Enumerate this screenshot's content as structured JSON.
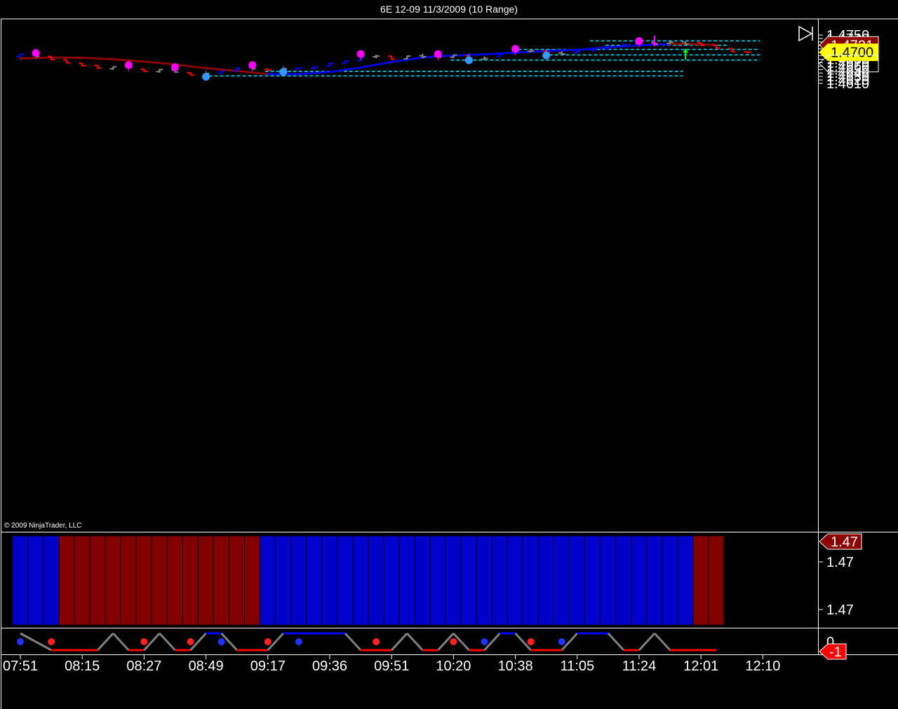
{
  "window": {
    "title": "6E 12-09  11/3/2009 (10 Range)"
  },
  "copyright": "© 2009 NinjaTrader, LLC",
  "colors": {
    "background": "#000000",
    "up_bar": "#0000ff",
    "down_bar": "#ff0000",
    "neutral_bar": "#808080",
    "ma_up": "#0000e0",
    "ma_down": "#8b0000",
    "level_line": "#00e5ff",
    "high_dot": "#ff00ff",
    "low_dot": "#3399ff",
    "last_badge_bg": "#ffff00",
    "prev_badge_bg": "#8b0000",
    "panel_up": "#0000cc",
    "panel_down": "#800000",
    "osc_line": "#808080"
  },
  "chart_data": [
    {
      "type": "ohlc",
      "title": "6E 12-09  11/3/2009 (10 Range)",
      "ylim": [
        1.4605,
        1.4755
      ],
      "yticks": [
        "1.4750",
        "1.4740",
        "1.4730",
        "1.4720",
        "1.4710",
        "1.4700",
        "1.4690",
        "1.4680",
        "1.4670",
        "1.4660",
        "1.4650",
        "1.4640",
        "1.4630",
        "1.4620",
        "1.4610"
      ],
      "ytick_values": [
        1.475,
        1.474,
        1.473,
        1.472,
        1.471,
        1.47,
        1.469,
        1.468,
        1.467,
        1.466,
        1.465,
        1.464,
        1.463,
        1.462,
        1.461
      ],
      "x_time_labels": [
        "07:51",
        "08:15",
        "08:27",
        "08:49",
        "09:17",
        "09:36",
        "09:51",
        "10:20",
        "10:38",
        "11:05",
        "11:24",
        "12:01",
        "12:10"
      ],
      "x_time_label_bar_index": [
        0,
        4,
        8,
        12,
        16,
        20,
        24,
        28,
        32,
        36,
        40,
        44,
        48
      ],
      "bars": [
        {
          "o": 1.4688,
          "h": 1.4695,
          "l": 1.4685,
          "c": 1.4694,
          "color": "up"
        },
        {
          "o": 1.4693,
          "h": 1.4697,
          "l": 1.4687,
          "c": 1.4688,
          "color": "neutral"
        },
        {
          "o": 1.4688,
          "h": 1.4688,
          "l": 1.4678,
          "c": 1.4679,
          "color": "down"
        },
        {
          "o": 1.4678,
          "h": 1.4678,
          "l": 1.4668,
          "c": 1.4669,
          "color": "down"
        },
        {
          "o": 1.4668,
          "h": 1.4668,
          "l": 1.466,
          "c": 1.4661,
          "color": "down"
        },
        {
          "o": 1.4662,
          "h": 1.4663,
          "l": 1.4653,
          "c": 1.4654,
          "color": "down"
        },
        {
          "o": 1.4652,
          "h": 1.4659,
          "l": 1.4649,
          "c": 1.4658,
          "color": "neutral"
        },
        {
          "o": 1.4658,
          "h": 1.4661,
          "l": 1.4652,
          "c": 1.4656,
          "color": "neutral"
        },
        {
          "o": 1.4651,
          "h": 1.4652,
          "l": 1.4644,
          "c": 1.4645,
          "color": "down"
        },
        {
          "o": 1.4644,
          "h": 1.4652,
          "l": 1.4641,
          "c": 1.465,
          "color": "neutral"
        },
        {
          "o": 1.4648,
          "h": 1.4655,
          "l": 1.4642,
          "c": 1.4643,
          "color": "neutral"
        },
        {
          "o": 1.4641,
          "h": 1.4641,
          "l": 1.4634,
          "c": 1.4634,
          "color": "down"
        },
        {
          "o": 1.4632,
          "h": 1.464,
          "l": 1.463,
          "c": 1.4639,
          "color": "neutral"
        },
        {
          "o": 1.464,
          "h": 1.4646,
          "l": 1.4638,
          "c": 1.4645,
          "color": "up"
        },
        {
          "o": 1.4647,
          "h": 1.4655,
          "l": 1.4645,
          "c": 1.4654,
          "color": "up"
        },
        {
          "o": 1.4656,
          "h": 1.4661,
          "l": 1.465,
          "c": 1.4652,
          "color": "neutral"
        },
        {
          "o": 1.4651,
          "h": 1.4653,
          "l": 1.4647,
          "c": 1.4648,
          "color": "down"
        },
        {
          "o": 1.4648,
          "h": 1.4654,
          "l": 1.4644,
          "c": 1.4653,
          "color": "neutral"
        },
        {
          "o": 1.4652,
          "h": 1.4655,
          "l": 1.4649,
          "c": 1.4655,
          "color": "up"
        },
        {
          "o": 1.4653,
          "h": 1.4659,
          "l": 1.4651,
          "c": 1.4658,
          "color": "up"
        },
        {
          "o": 1.466,
          "h": 1.4669,
          "l": 1.4659,
          "c": 1.4668,
          "color": "up"
        },
        {
          "o": 1.4668,
          "h": 1.4676,
          "l": 1.4666,
          "c": 1.4675,
          "color": "up"
        },
        {
          "o": 1.4676,
          "h": 1.4686,
          "l": 1.4675,
          "c": 1.4685,
          "color": "up"
        },
        {
          "o": 1.4687,
          "h": 1.4693,
          "l": 1.4683,
          "c": 1.4689,
          "color": "neutral"
        },
        {
          "o": 1.4689,
          "h": 1.4689,
          "l": 1.4679,
          "c": 1.468,
          "color": "down"
        },
        {
          "o": 1.4681,
          "h": 1.469,
          "l": 1.4679,
          "c": 1.4689,
          "color": "neutral"
        },
        {
          "o": 1.469,
          "h": 1.4695,
          "l": 1.4683,
          "c": 1.4687,
          "color": "neutral"
        },
        {
          "o": 1.4688,
          "h": 1.4691,
          "l": 1.4683,
          "c": 1.4686,
          "color": "neutral"
        },
        {
          "o": 1.4686,
          "h": 1.4693,
          "l": 1.4683,
          "c": 1.4692,
          "color": "neutral"
        },
        {
          "o": 1.469,
          "h": 1.469,
          "l": 1.468,
          "c": 1.4681,
          "color": "down"
        },
        {
          "o": 1.468,
          "h": 1.4688,
          "l": 1.4678,
          "c": 1.4682,
          "color": "neutral"
        },
        {
          "o": 1.4688,
          "h": 1.4695,
          "l": 1.4686,
          "c": 1.4694,
          "color": "up"
        },
        {
          "o": 1.4696,
          "h": 1.4702,
          "l": 1.4694,
          "c": 1.4701,
          "color": "up"
        },
        {
          "o": 1.4703,
          "h": 1.4709,
          "l": 1.4699,
          "c": 1.4704,
          "color": "neutral"
        },
        {
          "o": 1.4704,
          "h": 1.4706,
          "l": 1.4697,
          "c": 1.4699,
          "color": "down"
        },
        {
          "o": 1.4698,
          "h": 1.4703,
          "l": 1.4694,
          "c": 1.4695,
          "color": "neutral"
        },
        {
          "o": 1.4699,
          "h": 1.4705,
          "l": 1.4697,
          "c": 1.4704,
          "color": "up"
        },
        {
          "o": 1.4708,
          "h": 1.4709,
          "l": 1.4702,
          "c": 1.4707,
          "color": "up"
        },
        {
          "o": 1.4709,
          "h": 1.4717,
          "l": 1.4708,
          "c": 1.4716,
          "color": "up"
        },
        {
          "o": 1.4718,
          "h": 1.4725,
          "l": 1.4716,
          "c": 1.4722,
          "color": "up"
        },
        {
          "o": 1.4725,
          "h": 1.4732,
          "l": 1.4723,
          "c": 1.4727,
          "color": "neutral"
        },
        {
          "o": 1.4728,
          "h": 1.473,
          "l": 1.4722,
          "c": 1.4723,
          "color": "neutral"
        },
        {
          "o": 1.4726,
          "h": 1.4731,
          "l": 1.4724,
          "c": 1.4729,
          "color": "neutral"
        },
        {
          "o": 1.4729,
          "h": 1.4731,
          "l": 1.4721,
          "c": 1.4723,
          "color": "neutral"
        },
        {
          "o": 1.4728,
          "h": 1.4728,
          "l": 1.4719,
          "c": 1.472,
          "color": "down"
        },
        {
          "o": 1.472,
          "h": 1.4721,
          "l": 1.4711,
          "c": 1.4712,
          "color": "down"
        },
        {
          "o": 1.4711,
          "h": 1.4711,
          "l": 1.4701,
          "c": 1.4702,
          "color": "down"
        },
        {
          "o": 1.4701,
          "h": 1.4702,
          "l": 1.4698,
          "c": 1.47,
          "color": "down"
        }
      ],
      "moving_average": [
        {
          "i": 0,
          "v": 1.4682,
          "trend": "down"
        },
        {
          "i": 2,
          "v": 1.4685,
          "trend": "down"
        },
        {
          "i": 4,
          "v": 1.4684,
          "trend": "down"
        },
        {
          "i": 6,
          "v": 1.468,
          "trend": "down"
        },
        {
          "i": 8,
          "v": 1.4673,
          "trend": "down"
        },
        {
          "i": 10,
          "v": 1.4665,
          "trend": "down"
        },
        {
          "i": 12,
          "v": 1.4654,
          "trend": "down"
        },
        {
          "i": 14,
          "v": 1.4646,
          "trend": "down"
        },
        {
          "i": 16,
          "v": 1.4637,
          "trend": "down"
        },
        {
          "i": 18,
          "v": 1.4637,
          "trend": "up"
        },
        {
          "i": 20,
          "v": 1.4643,
          "trend": "up"
        },
        {
          "i": 22,
          "v": 1.4656,
          "trend": "up"
        },
        {
          "i": 24,
          "v": 1.4672,
          "trend": "up"
        },
        {
          "i": 26,
          "v": 1.4685,
          "trend": "up"
        },
        {
          "i": 28,
          "v": 1.4691,
          "trend": "up"
        },
        {
          "i": 30,
          "v": 1.4694,
          "trend": "up"
        },
        {
          "i": 32,
          "v": 1.4699,
          "trend": "up"
        },
        {
          "i": 34,
          "v": 1.4704,
          "trend": "up"
        },
        {
          "i": 36,
          "v": 1.4707,
          "trend": "up"
        },
        {
          "i": 38,
          "v": 1.4715,
          "trend": "up"
        },
        {
          "i": 40,
          "v": 1.472,
          "trend": "up"
        },
        {
          "i": 42,
          "v": 1.4724,
          "trend": "up"
        },
        {
          "i": 43,
          "v": 1.4725,
          "trend": "down"
        },
        {
          "i": 45,
          "v": 1.4721,
          "trend": "down"
        }
      ],
      "levels": [
        {
          "price": 1.4733,
          "from_bar": 37,
          "to_bar": 47
        },
        {
          "price": 1.47205,
          "from_bar": 38,
          "to_bar": 45
        },
        {
          "price": 1.47085,
          "from_bar": 32,
          "to_bar": 47
        },
        {
          "price": 1.46925,
          "from_bar": 34,
          "to_bar": 47
        },
        {
          "price": 1.46775,
          "from_bar": 28,
          "to_bar": 47
        },
        {
          "price": 1.4645,
          "from_bar": 16,
          "to_bar": 42
        },
        {
          "price": 1.46315,
          "from_bar": 12,
          "to_bar": 42
        }
      ],
      "pivot_highs": [
        {
          "bar": 1,
          "price": 1.4698
        },
        {
          "bar": 7,
          "price": 1.4663
        },
        {
          "bar": 10,
          "price": 1.4657
        },
        {
          "bar": 15,
          "price": 1.4663
        },
        {
          "bar": 22,
          "price": 1.4695
        },
        {
          "bar": 27,
          "price": 1.4695
        },
        {
          "bar": 32,
          "price": 1.471
        },
        {
          "bar": 40,
          "price": 1.47325
        }
      ],
      "pivot_lows": [
        {
          "bar": 12,
          "price": 1.4629
        },
        {
          "bar": 17,
          "price": 1.4643
        },
        {
          "bar": 29,
          "price": 1.4677
        },
        {
          "bar": 34,
          "price": 1.4691
        }
      ],
      "arrows": [
        {
          "bar": 41,
          "price": 1.4732,
          "dir": "down",
          "color": "#ff00ff"
        },
        {
          "bar": 43,
          "price": 1.4699,
          "dir": "up",
          "color": "#00ff00"
        }
      ],
      "last_price": "1.4700",
      "last_price_value": 1.47,
      "prev_close": "1.4721",
      "prev_close_value": 1.4721,
      "hollow_marker_value": 1.4688
    },
    {
      "type": "bar",
      "title": "",
      "yticks": [
        "1.47",
        "1.47"
      ],
      "badge": "1.47",
      "colors_sequence": [
        "up",
        "up",
        "up",
        "down",
        "down",
        "down",
        "down",
        "down",
        "down",
        "down",
        "down",
        "down",
        "down",
        "down",
        "down",
        "down",
        "up",
        "up",
        "up",
        "up",
        "up",
        "up",
        "up",
        "up",
        "up",
        "up",
        "up",
        "up",
        "up",
        "up",
        "up",
        "up",
        "up",
        "up",
        "up",
        "up",
        "up",
        "up",
        "up",
        "up",
        "up",
        "up",
        "up",
        "up",
        "down",
        "down"
      ]
    },
    {
      "type": "line",
      "title": "",
      "yticks": [
        "0"
      ],
      "badge": "-1",
      "badge_value": -1,
      "osc_values": [
        1,
        0,
        -1,
        -1,
        -1,
        -1,
        1,
        -1,
        -1,
        1,
        -1,
        -1,
        1,
        1,
        -1,
        -1,
        -1,
        1,
        1,
        1,
        1,
        1,
        -1,
        -1,
        -1,
        1,
        -1,
        -1,
        1,
        -1,
        -1,
        1,
        1,
        -1,
        -1,
        -1,
        1,
        1,
        1,
        -1,
        -1,
        1,
        -1,
        -1,
        -1,
        -1
      ],
      "red_dots_bars": [
        2,
        8,
        11,
        16,
        23,
        28,
        33
      ],
      "blue_dots_bars": [
        0,
        13,
        18,
        30,
        35
      ]
    }
  ]
}
